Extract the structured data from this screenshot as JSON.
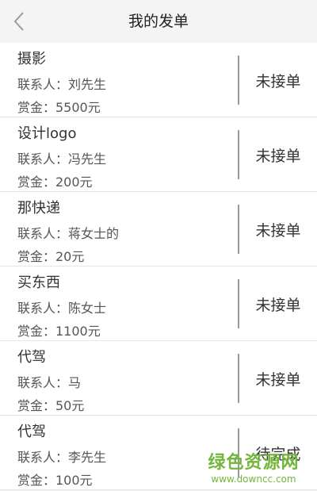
{
  "header": {
    "back_icon": "chevron-left-icon",
    "title": "我的发单"
  },
  "orders": [
    {
      "name": "摄影",
      "contact": "联系人：刘先生",
      "reward": "赏金：5500元",
      "status": "未接单"
    },
    {
      "name": "设计logo",
      "contact": "联系人：冯先生",
      "reward": "赏金：200元",
      "status": "未接单"
    },
    {
      "name": "那快递",
      "contact": "联系人：蒋女士的",
      "reward": "赏金：20元",
      "status": "未接单"
    },
    {
      "name": "买东西",
      "contact": "联系人：陈女士",
      "reward": "赏金：1100元",
      "status": "未接单"
    },
    {
      "name": "代驾",
      "contact": "联系人：马",
      "reward": "赏金：50元",
      "status": "未接单"
    },
    {
      "name": "代驾",
      "contact": "联系人：李先生",
      "reward": "赏金：100元",
      "status": "待完成"
    }
  ],
  "watermark": {
    "text": "绿色资源网",
    "url": "www.downcc.com"
  },
  "colors": {
    "background": "#f2f2f2",
    "card": "#ffffff",
    "divider": "#9a9a9a",
    "watermark": "#74b63c"
  }
}
